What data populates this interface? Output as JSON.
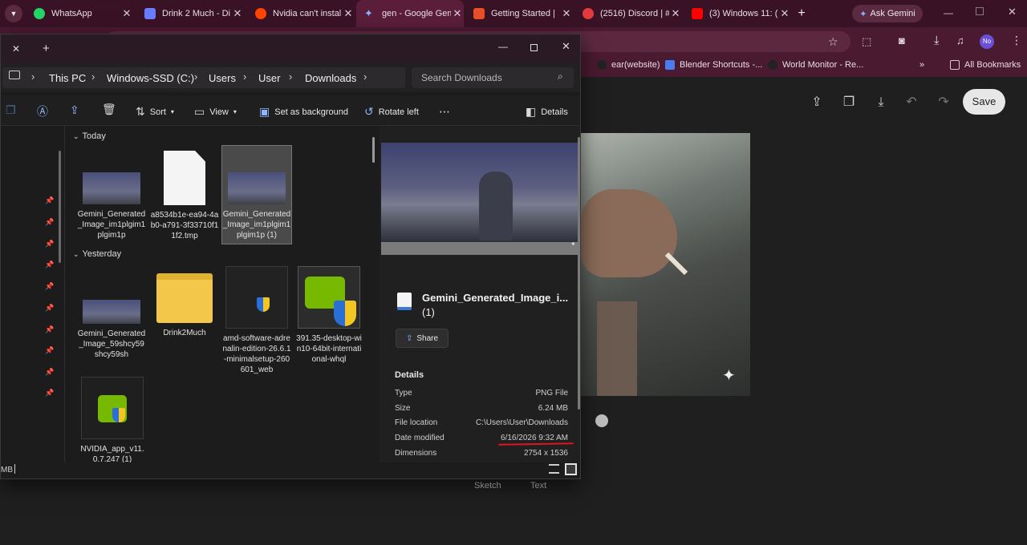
{
  "browser": {
    "tabs": [
      {
        "label": "WhatsApp",
        "color": "#25d366"
      },
      {
        "label": "Drink 2 Much - Di",
        "color": "#6b7dff"
      },
      {
        "label": "Nvidia can't instal",
        "color": "#ff4500"
      },
      {
        "label": "gen - Google Gem",
        "color": "#4e8cff"
      },
      {
        "label": "Getting Started |",
        "color": "#e8502a"
      },
      {
        "label": "(2516) Discord | #",
        "color": "#e33b3b"
      },
      {
        "label": "(3) Windows 11: (",
        "color": "#ff0000"
      }
    ],
    "ask_gemini": "Ask Gemini",
    "profile_initials": "No",
    "bookmarks": [
      {
        "label": "ear(website)"
      },
      {
        "label": "Blender Shortcuts -..."
      },
      {
        "label": "World Monitor - Re..."
      }
    ],
    "all_bookmarks": "All Bookmarks"
  },
  "gemini": {
    "save_label": "Save",
    "sketch_label": "Sketch",
    "text_label": "Text"
  },
  "explorer": {
    "breadcrumb": [
      "This PC",
      "Windows-SSD (C:)",
      "Users",
      "User",
      "Downloads"
    ],
    "search_placeholder": "Search Downloads",
    "commands": {
      "sort": "Sort",
      "view": "View",
      "set_background": "Set as background",
      "rotate_left": "Rotate left",
      "details": "Details"
    },
    "groups": {
      "today": "Today",
      "yesterday": "Yesterday"
    },
    "files_today": [
      {
        "name": "Gemini_Generated_Image_im1plgim1plgim1p"
      },
      {
        "name": "a8534b1e-ea94-4ab0-a791-3f33710f11f2.tmp"
      },
      {
        "name": "Gemini_Generated_Image_im1plgim1plgim1p (1)"
      }
    ],
    "files_yesterday": [
      {
        "name": "Gemini_Generated_Image_59shcy59shcy59sh"
      },
      {
        "name": "Drink2Much"
      },
      {
        "name": "amd-software-adrenalin-edition-26.6.1-minimalsetup-260601_web"
      },
      {
        "name": "391.35-desktop-win10-64bit-international-whql"
      },
      {
        "name": "NVIDIA_app_v11.0.7.247 (1)"
      }
    ],
    "preview": {
      "title": "Gemini_Generated_Image_i...",
      "title_suffix": "(1)",
      "share": "Share",
      "details_heading": "Details",
      "details": [
        {
          "key": "Type",
          "value": "PNG File"
        },
        {
          "key": "Size",
          "value": "6.24 MB"
        },
        {
          "key": "File location",
          "value": "C:\\Users\\User\\Downloads"
        },
        {
          "key": "Date modified",
          "value": "6/16/2026 9:32 AM"
        },
        {
          "key": "Dimensions",
          "value": "2754 x 1536"
        }
      ]
    },
    "status_text": "MB"
  }
}
